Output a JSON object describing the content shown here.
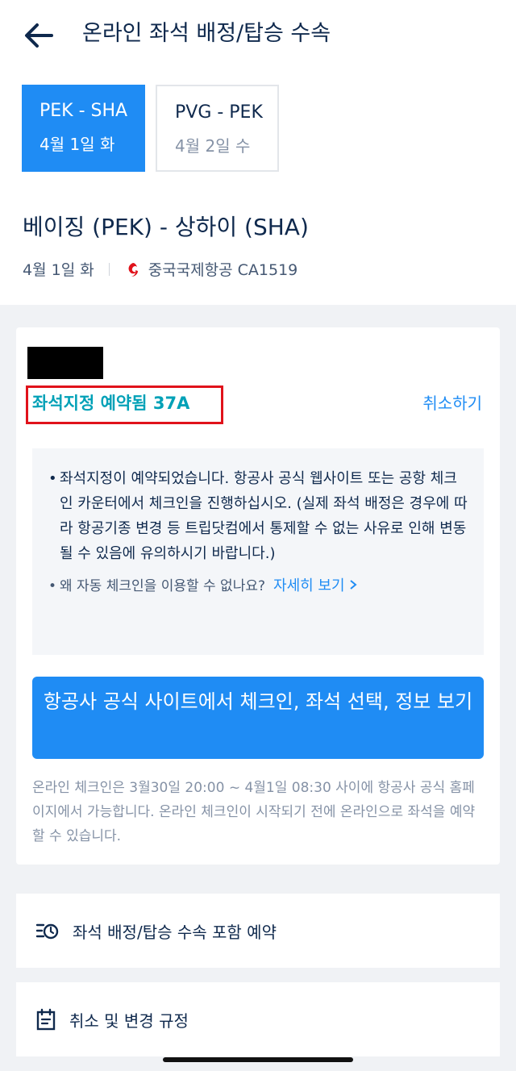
{
  "header": {
    "title": "온라인 좌석 배정/탑승 수속"
  },
  "tabs": [
    {
      "route": "PEK - SHA",
      "date": "4월 1일 화",
      "active": true
    },
    {
      "route": "PVG - PEK",
      "date": "4월 2일 수",
      "active": false
    }
  ],
  "flight": {
    "title": "베이징 (PEK) - 상하이 (SHA)",
    "date": "4월 1일 화",
    "airline": "중국국제항공 CA1519"
  },
  "card": {
    "seat_status": "좌석지정 예약됨 37A",
    "cancel_label": "취소하기",
    "notice_text": "좌석지정이 예약되었습니다. 항공사 공식 웹사이트 또는 공항 체크인 카운터에서 체크인을 진행하십시오. (실제 좌석 배정은 경우에 따라 항공기종 변경 등 트립닷컴에서 통제할 수 없는 사유로 인해 변동될 수 있음에 유의하시기 바랍니다.)",
    "question_text": "왜 자동 체크인을 이용할 수 없나요?",
    "more_label": "자세히 보기",
    "cta_label": "항공사 공식 사이트에서 체크인, 좌석 선택, 정보 보기",
    "footnote": "온라인 체크인은 3월30일 20:00 ~ 4월1일 08:30 사이에 항공사 공식 홈페이지에서 가능합니다. 온라인 체크인이 시작되기 전에 온라인으로 좌석을 예약할 수 있습니다."
  },
  "rows": {
    "booking_label": "좌석 배정/탑승 수속 포함 예약",
    "policy_label": "취소 및 변경 규정"
  },
  "icons": {
    "back": "arrow-left-icon",
    "airline": "air-china-logo-icon",
    "booking": "clock-list-icon",
    "policy": "calendar-clipboard-icon",
    "more": "chevron-right-icon"
  },
  "colors": {
    "primary": "#1f8cf4",
    "seat_status": "#00a1b7",
    "highlight_box": "#e0121b",
    "text": "#0f294d",
    "muted": "#8592a6"
  }
}
